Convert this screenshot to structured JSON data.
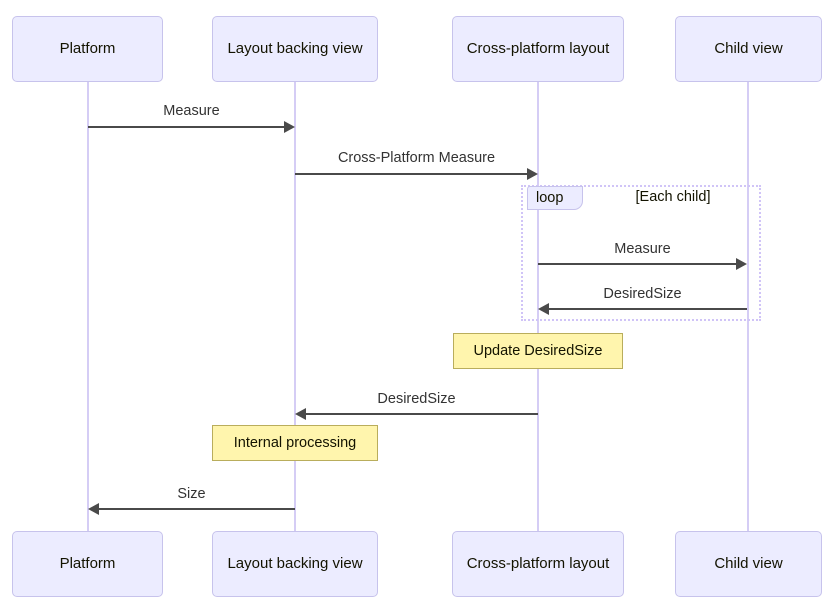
{
  "diagram": {
    "type": "sequence-diagram",
    "title": "",
    "colors": {
      "actor_fill": "#ececff",
      "actor_border": "#c7c3ec",
      "lifeline": "#d5cdf5",
      "message_line": "#4a4a4a",
      "note_fill": "#fff5ad",
      "note_border": "#b9ad5c",
      "loop_border": "#d0c4f7",
      "background": "#ffffff"
    }
  },
  "participants": [
    {
      "id": "platform",
      "label": "Platform"
    },
    {
      "id": "backingview",
      "label": "Layout backing view"
    },
    {
      "id": "crosslayout",
      "label": "Cross-platform layout"
    },
    {
      "id": "childview",
      "label": "Child view"
    }
  ],
  "messages": [
    {
      "id": "m1",
      "label": "Measure",
      "from": "platform",
      "to": "backingview",
      "direction": "right"
    },
    {
      "id": "m2",
      "label": "Cross-Platform Measure",
      "from": "backingview",
      "to": "crosslayout",
      "direction": "right"
    },
    {
      "id": "m3",
      "label": "Measure",
      "from": "crosslayout",
      "to": "childview",
      "direction": "right"
    },
    {
      "id": "m4",
      "label": "DesiredSize",
      "from": "childview",
      "to": "crosslayout",
      "direction": "left"
    },
    {
      "id": "m5",
      "label": "DesiredSize",
      "from": "crosslayout",
      "to": "backingview",
      "direction": "left"
    },
    {
      "id": "m6",
      "label": "Size",
      "from": "backingview",
      "to": "platform",
      "direction": "left"
    }
  ],
  "fragments": [
    {
      "id": "loop1",
      "kind": "loop",
      "keyword": "loop",
      "condition": "[Each child]"
    }
  ],
  "notes": [
    {
      "id": "n1",
      "text": "Update DesiredSize",
      "over": "crosslayout"
    },
    {
      "id": "n2",
      "text": "Internal processing",
      "over": "backingview"
    }
  ]
}
